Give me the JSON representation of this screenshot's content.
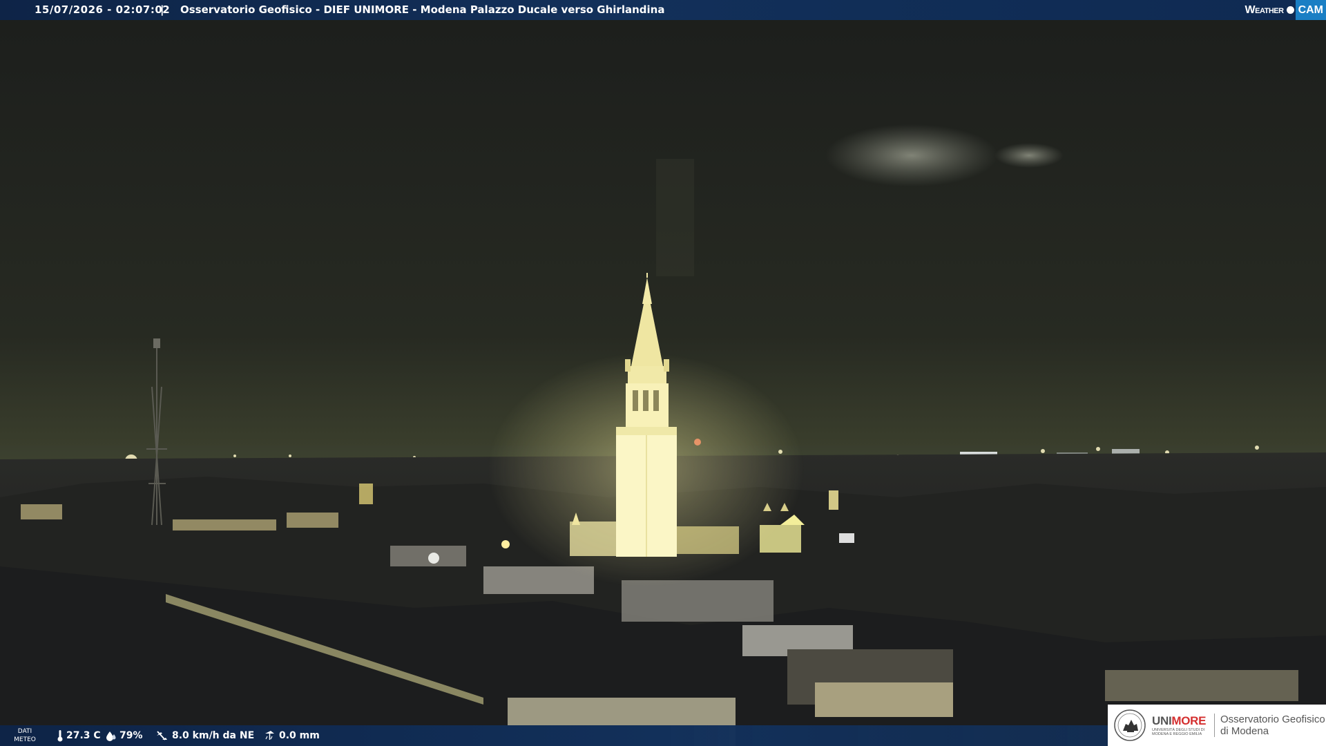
{
  "header": {
    "timestamp": "15/07/2026 - 02:07:02",
    "separator": "|",
    "camera_title": "Osservatorio Geofisico - DIEF UNIMORE - Modena Palazzo Ducale verso Ghirlandina",
    "logo_weather": "Weather",
    "logo_cam": "CAM"
  },
  "weather": {
    "section_label": "DATI METEO",
    "temperature": "27.3 C",
    "humidity": "79%",
    "wind": "8.0 km/h da NE",
    "rain": "0.0 mm"
  },
  "footer_logo": {
    "uni": "UNI",
    "more": "MORE",
    "subtitle": "UNIVERSITÀ DEGLI STUDI DI MODENA E REGGIO EMILIA",
    "observatory_line1": "Osservatorio Geofisico",
    "observatory_line2": "di Modena"
  },
  "colors": {
    "bar_blue": "#12305a",
    "logo_cam_blue": "#1a7fc4",
    "unimore_red": "#d42f2f",
    "night_sky": "#23251e",
    "tower_light": "#fffbd0"
  },
  "icons": {
    "temperature": "thermometer-icon",
    "humidity": "drop-icon",
    "wind": "wind-icon",
    "rain": "rain-gauge-icon"
  }
}
